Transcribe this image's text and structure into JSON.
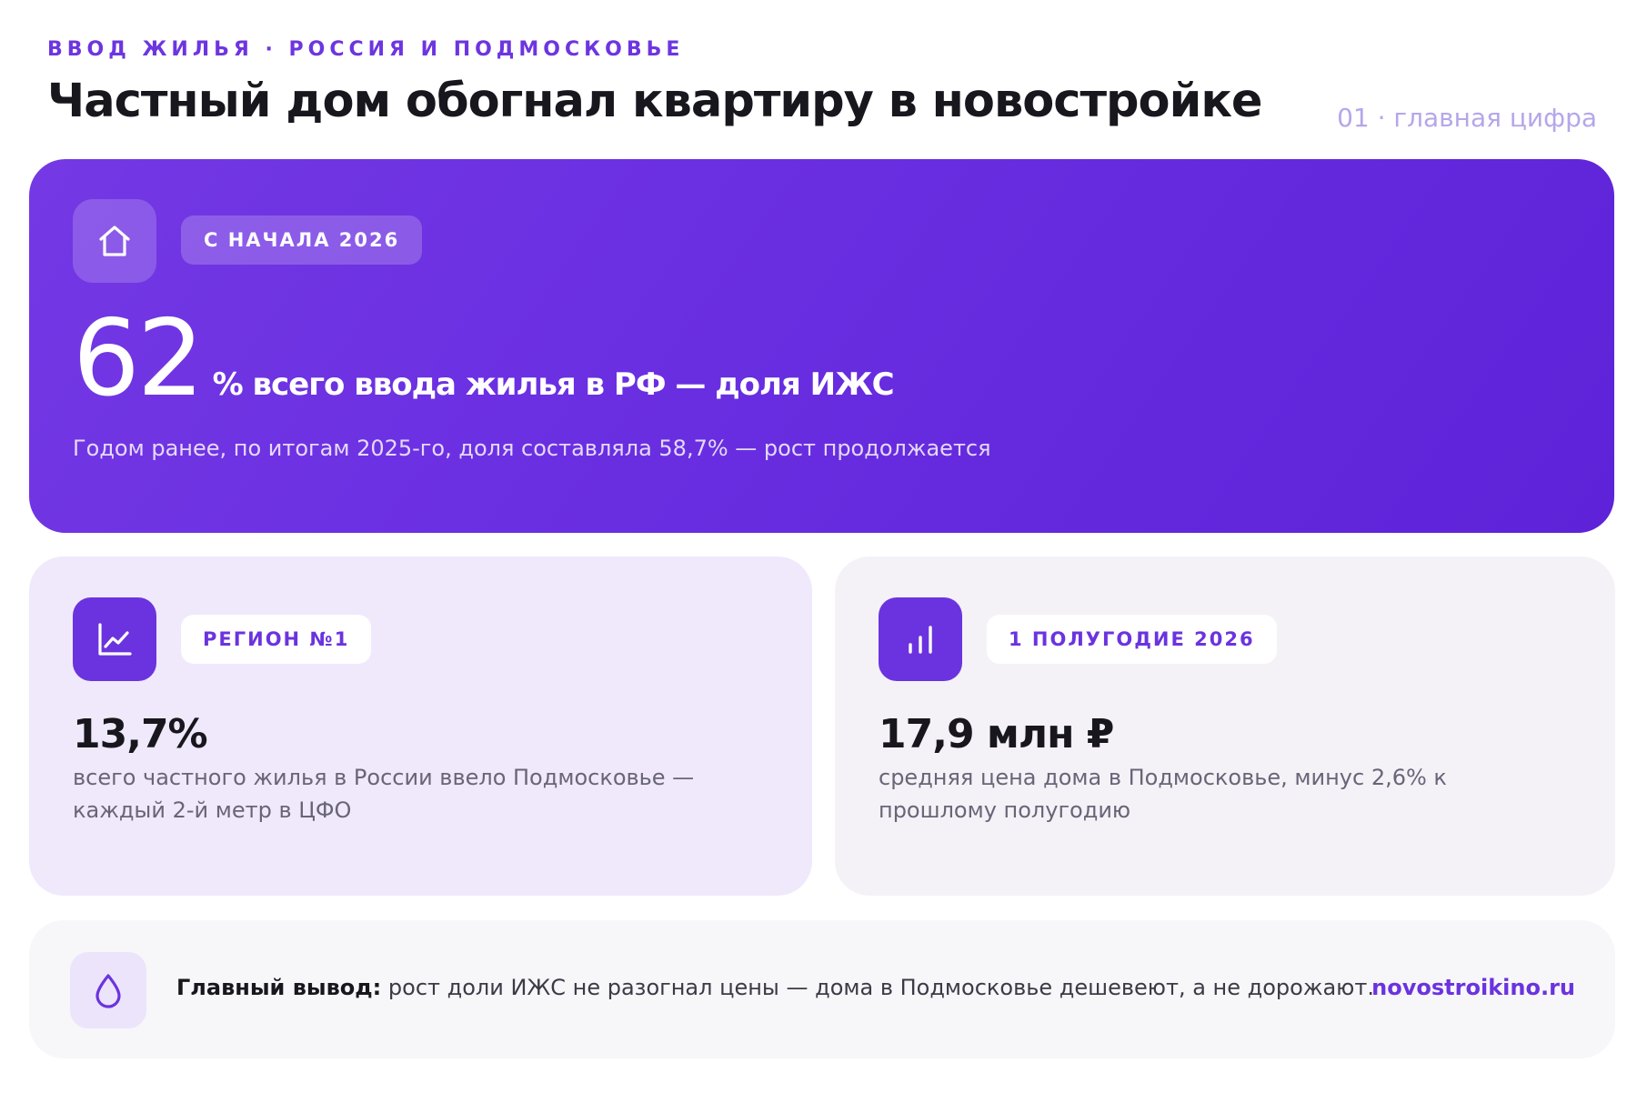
{
  "header": {
    "eyebrow": "ВВОД ЖИЛЬЯ · РОССИЯ И ПОДМОСКОВЬЕ",
    "title": "Частный дом обогнал квартиру в новостройке",
    "slide_label": "01 · главная цифра"
  },
  "hero": {
    "icon": "home-icon",
    "badge": "С НАЧАЛА 2026",
    "value": "62",
    "caption": "% всего ввода жилья в РФ — доля ИЖС",
    "note": "Годом ранее, по итогам 2025-го, доля составляла 58,7% — рост продолжается"
  },
  "cards": [
    {
      "icon": "line-chart-icon",
      "badge": "РЕГИОН №1",
      "value": "13,7%",
      "text": "всего частного жилья в России ввело Подмосковье — каждый 2-й метр в ЦФО"
    },
    {
      "icon": "bar-chart-icon",
      "badge": "1 ПОЛУГОДИЕ 2026",
      "value": "17,9 млн ₽",
      "text": "средняя цена дома в Подмосковье, минус 2,6% к прошлому полугодию"
    }
  ],
  "summary": {
    "icon": "drop-icon",
    "lead": "Главный вывод:",
    "text": " рост доли ИЖС не разогнал цены — дома в Подмосковье дешевеют, а не дорожают.",
    "source": "novostroikino.ru"
  },
  "colors": {
    "accent": "#6b33df",
    "hero_gradient_start": "#7438e4",
    "hero_gradient_end": "#5e22d8",
    "card_left_bg": "#efe9fb",
    "card_right_bg": "#f4f2f7"
  }
}
